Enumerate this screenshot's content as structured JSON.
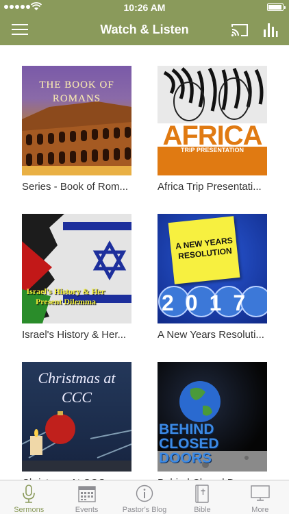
{
  "status_bar": {
    "time": "10:26 AM"
  },
  "header": {
    "title": "Watch & Listen"
  },
  "items": [
    {
      "title": "Series - Book of Rom...",
      "art_text": "THE BOOK OF ROMANS"
    },
    {
      "title": "Africa Trip Presentati...",
      "art_text": "AFRICA",
      "art_subtext": "TRIP PRESENTATION"
    },
    {
      "title": "Israel's History & Her...",
      "art_text": "Israel's History & Her Present Dilemma"
    },
    {
      "title": "A New Years Resoluti...",
      "art_text": "A NEW YEARS RESOLUTION",
      "art_year": "2017"
    },
    {
      "title": "Christmas At CCC",
      "art_text": "Christmas at CCC"
    },
    {
      "title": "Behind Closed Doors",
      "art_text": "BEHIND CLOSED DOORS"
    }
  ],
  "tabs": [
    {
      "label": "Sermons",
      "icon": "microphone-icon",
      "active": true
    },
    {
      "label": "Events",
      "icon": "calendar-icon",
      "active": false
    },
    {
      "label": "Pastor's Blog",
      "icon": "info-icon",
      "active": false
    },
    {
      "label": "Bible",
      "icon": "book-icon",
      "active": false
    },
    {
      "label": "More",
      "icon": "monitor-icon",
      "active": false
    }
  ],
  "colors": {
    "brand": "#8a9a5b",
    "tab_inactive": "#8e8e93"
  }
}
